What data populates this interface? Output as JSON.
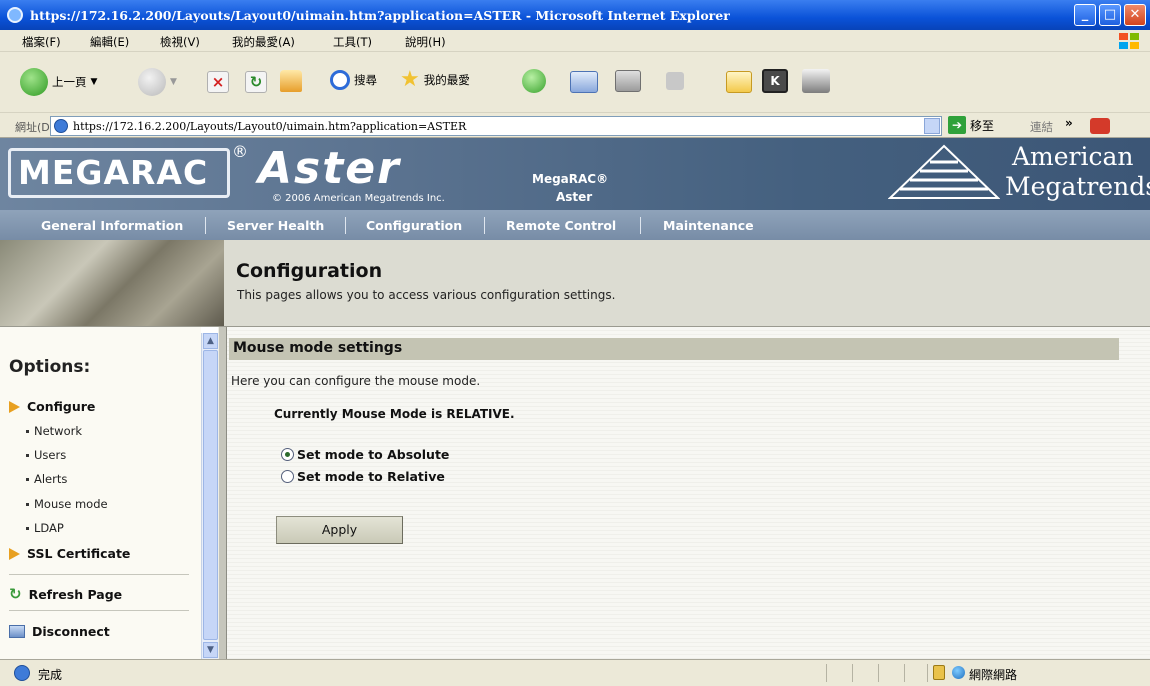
{
  "window": {
    "title": "https://172.16.2.200/Layouts/Layout0/uimain.htm?application=ASTER - Microsoft Internet Explorer"
  },
  "menubar": {
    "items": [
      "檔案(F)",
      "編輯(E)",
      "檢視(V)",
      "我的最愛(A)",
      "工具(T)",
      "說明(H)"
    ]
  },
  "toolbar": {
    "back_label": "上一頁",
    "search_label": "搜尋",
    "favorites_label": "我的最愛"
  },
  "addressbar": {
    "label": "網址(D)",
    "url": "https://172.16.2.200/Layouts/Layout0/uimain.htm?application=ASTER",
    "go_label": "移至",
    "links_label": "連結"
  },
  "banner": {
    "brand": "MEGARAC",
    "reg": "®",
    "product": "Aster",
    "copyright": "© 2006 American Megatrends Inc.",
    "product_line1": "MegaRAC®",
    "product_line2": "Aster",
    "company_line1": "American",
    "company_line2": "Megatrends"
  },
  "nav": {
    "items": [
      "General Information",
      "Server Health",
      "Configuration",
      "Remote Control",
      "Maintenance"
    ]
  },
  "header": {
    "title": "Configuration",
    "description": "This pages allows you to access various configuration settings."
  },
  "sidebar": {
    "title": "Options:",
    "configure_label": "Configure",
    "configure_items": [
      "Network",
      "Users",
      "Alerts",
      "Mouse mode",
      "LDAP"
    ],
    "ssl_label": "SSL Certificate",
    "refresh_label": "Refresh Page",
    "disconnect_label": "Disconnect"
  },
  "main": {
    "section_title": "Mouse mode settings",
    "description": "Here you can configure the mouse mode.",
    "current_mode": "Currently Mouse Mode is RELATIVE.",
    "options": [
      {
        "label": "Set mode to Absolute",
        "selected": true
      },
      {
        "label": "Set mode to Relative",
        "selected": false
      }
    ],
    "apply_label": "Apply"
  },
  "statusbar": {
    "done": "完成",
    "zone": "網際網路"
  },
  "colors": {
    "titlebar": "#0a52d8",
    "banner": "#5a728f",
    "nav": "#8499b1",
    "section_header": "#c4c4b3",
    "arrow_accent": "#e8a020"
  }
}
